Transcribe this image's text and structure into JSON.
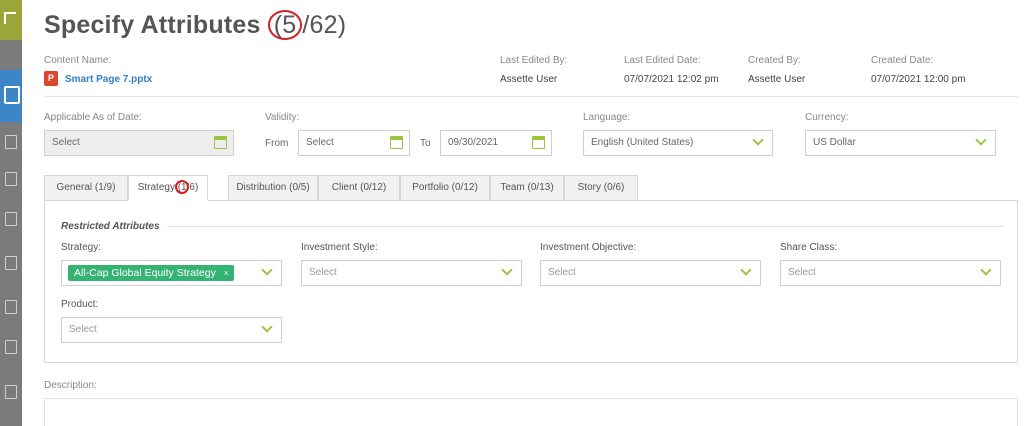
{
  "header": {
    "title": "Specify Attributes",
    "count_current": "5",
    "count_total": "/62)",
    "count_open": "("
  },
  "content": {
    "name_label": "Content Name:",
    "file_name": "Smart Page 7.pptx",
    "file_icon": "powerpoint-icon",
    "file_icon_glyph": "P"
  },
  "meta": {
    "last_edited_by_label": "Last Edited By:",
    "last_edited_by": "Assette User",
    "last_edited_date_label": "Last Edited Date:",
    "last_edited_date": "07/07/2021 12:02 pm",
    "created_by_label": "Created By:",
    "created_by": "Assette User",
    "created_date_label": "Created Date:",
    "created_date": "07/07/2021 12:00 pm"
  },
  "form": {
    "applicable_label": "Applicable As of Date:",
    "applicable_value": "Select",
    "validity_label": "Validity:",
    "from_label": "From",
    "from_value": "Select",
    "to_label": "To",
    "to_value": "09/30/2021",
    "language_label": "Language:",
    "language_value": "English (United States)",
    "currency_label": "Currency:",
    "currency_value": "US Dollar"
  },
  "tabs": [
    {
      "label": "General (1/9)"
    },
    {
      "label": "Strategy (1/6)"
    },
    {
      "label": "Distribution (0/5)"
    },
    {
      "label": "Client (0/12)"
    },
    {
      "label": "Portfolio (0/12)"
    },
    {
      "label": "Team (0/13)"
    },
    {
      "label": "Story (0/6)"
    }
  ],
  "strategy_panel": {
    "section_title": "Restricted Attributes",
    "strategy_label": "Strategy:",
    "strategy_tag": "All-Cap Global Equity Strategy",
    "strategy_tag_remove": "×",
    "investment_style_label": "Investment Style:",
    "investment_style_value": "Select",
    "investment_objective_label": "Investment Objective:",
    "investment_objective_value": "Select",
    "share_class_label": "Share Class:",
    "share_class_value": "Select",
    "product_label": "Product:",
    "product_value": "Select"
  },
  "description": {
    "label": "Description:"
  },
  "colors": {
    "accent_green": "#9bc53d",
    "tag_green": "#35b373",
    "link_blue": "#2f7fc4",
    "highlight_red": "#d32020"
  }
}
